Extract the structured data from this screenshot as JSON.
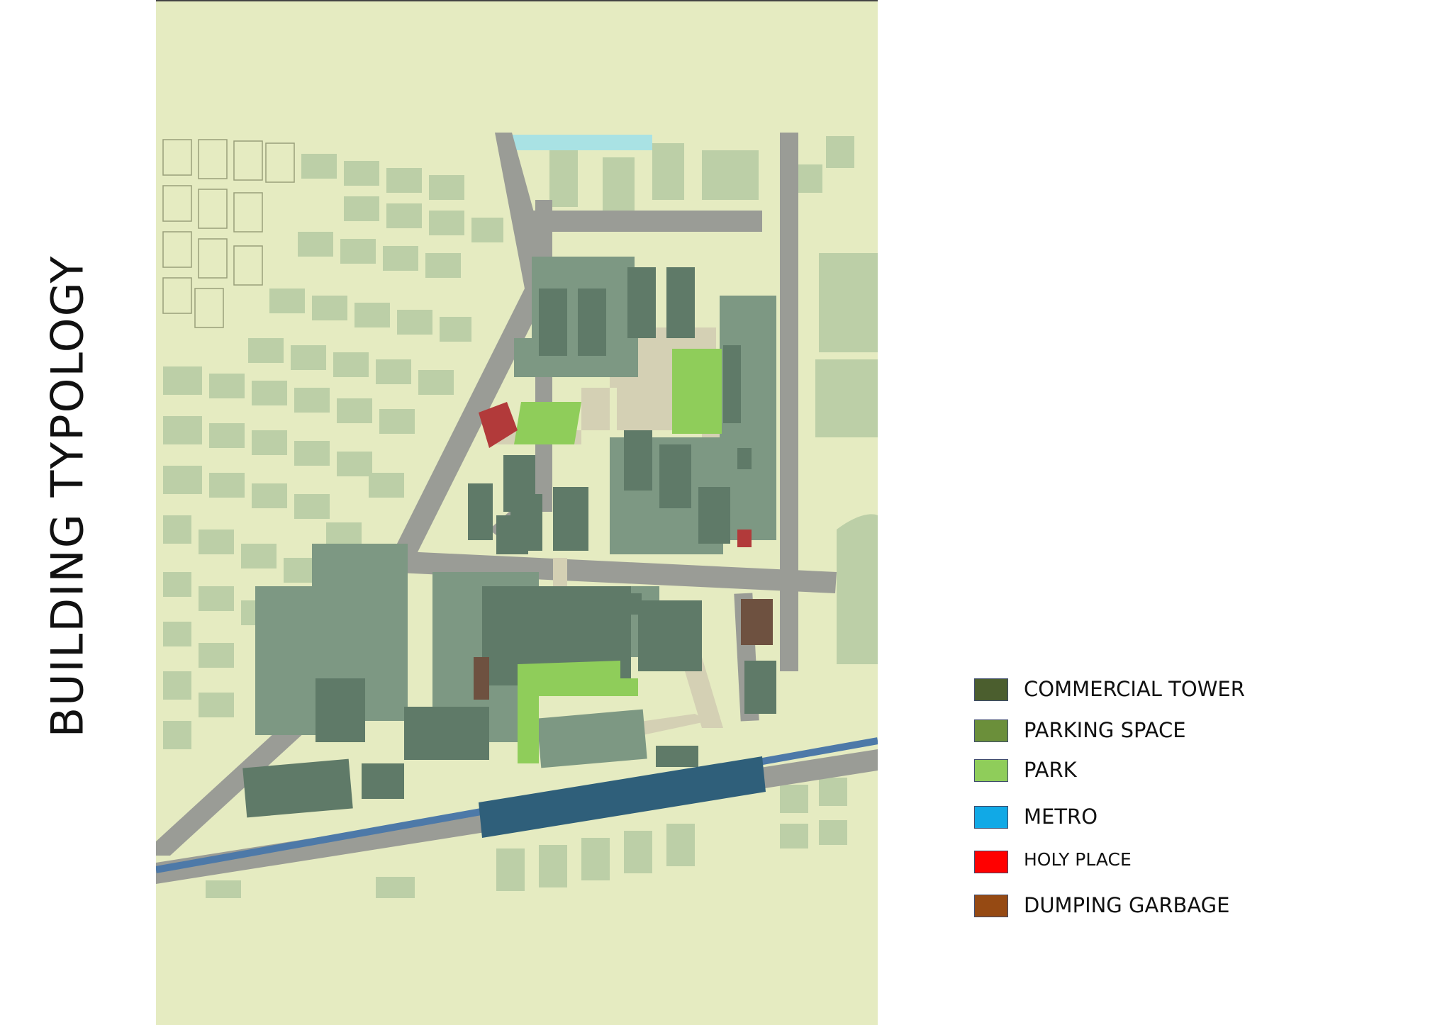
{
  "title": "BUILDING TYPOLOGY",
  "colors": {
    "map_background": "#e5ebc1",
    "road": "#9a9c96",
    "residential_block": "#bccfa7",
    "commercial_tower": "#5f7a68",
    "large_building": "#7d9883",
    "park": "#8fcd5a",
    "plaza": "#d4d0b4",
    "holy_place": "#b23a3a",
    "dumping_garbage": "#6e5140",
    "metro_station": "#2f5f7a",
    "metro_line": "#4d79a8",
    "water": "#a9e2e4"
  },
  "legend": [
    {
      "label": "COMMERCIAL TOWER",
      "color": "#4b5e2e",
      "icon": "commercial-tower-swatch"
    },
    {
      "label": "PARKING SPACE",
      "color": "#6b8f3a",
      "icon": "parking-space-swatch"
    },
    {
      "label": "PARK",
      "color": "#8fcd5a",
      "icon": "park-swatch"
    },
    {
      "label": "METRO",
      "color": "#11a9e6",
      "icon": "metro-swatch"
    },
    {
      "label": "HOLY PLACE",
      "color": "#ff0000",
      "icon": "holy-place-swatch"
    },
    {
      "label": "DUMPING GARBAGE",
      "color": "#964a13",
      "icon": "dumping-garbage-swatch"
    }
  ]
}
